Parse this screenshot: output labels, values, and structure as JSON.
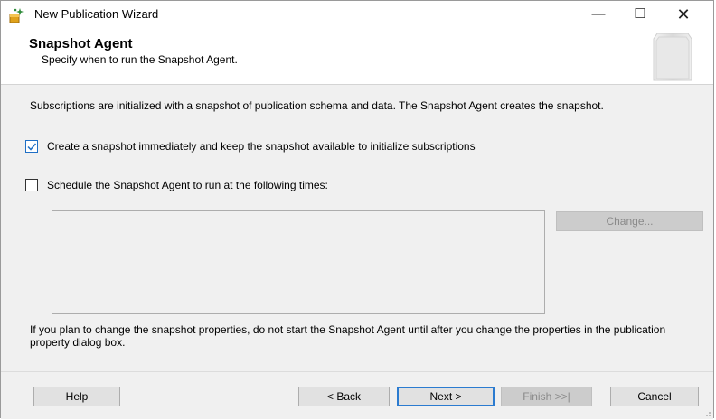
{
  "window": {
    "title": "New Publication Wizard",
    "controls": {
      "minimize": "—",
      "maximize": "☐",
      "close": "✕"
    }
  },
  "header": {
    "title": "Snapshot Agent",
    "subtitle": "Specify when to run the Snapshot Agent."
  },
  "content": {
    "intro": "Subscriptions are initialized with a snapshot of publication schema and data. The Snapshot Agent creates the snapshot.",
    "options": [
      {
        "label": "Create a snapshot immediately and keep the snapshot available to initialize subscriptions",
        "checked": true
      },
      {
        "label": "Schedule the Snapshot Agent to run at the following times:",
        "checked": false
      }
    ],
    "schedule_text": "",
    "change_label": "Change...",
    "note": "If you plan to change the snapshot properties, do not start the Snapshot Agent until after you change the properties in the publication property dialog box."
  },
  "footer": {
    "help": "Help",
    "back": "< Back",
    "next": "Next >",
    "finish": "Finish >>|",
    "cancel": "Cancel"
  },
  "colors": {
    "accent": "#2b7bd0",
    "disabled_bg": "#cccccc",
    "dialog_bg": "#f0f0f0"
  },
  "icons": [
    "app-wizard-icon",
    "header-graphic",
    "checkmark-icon",
    "resize-grip-icon"
  ]
}
